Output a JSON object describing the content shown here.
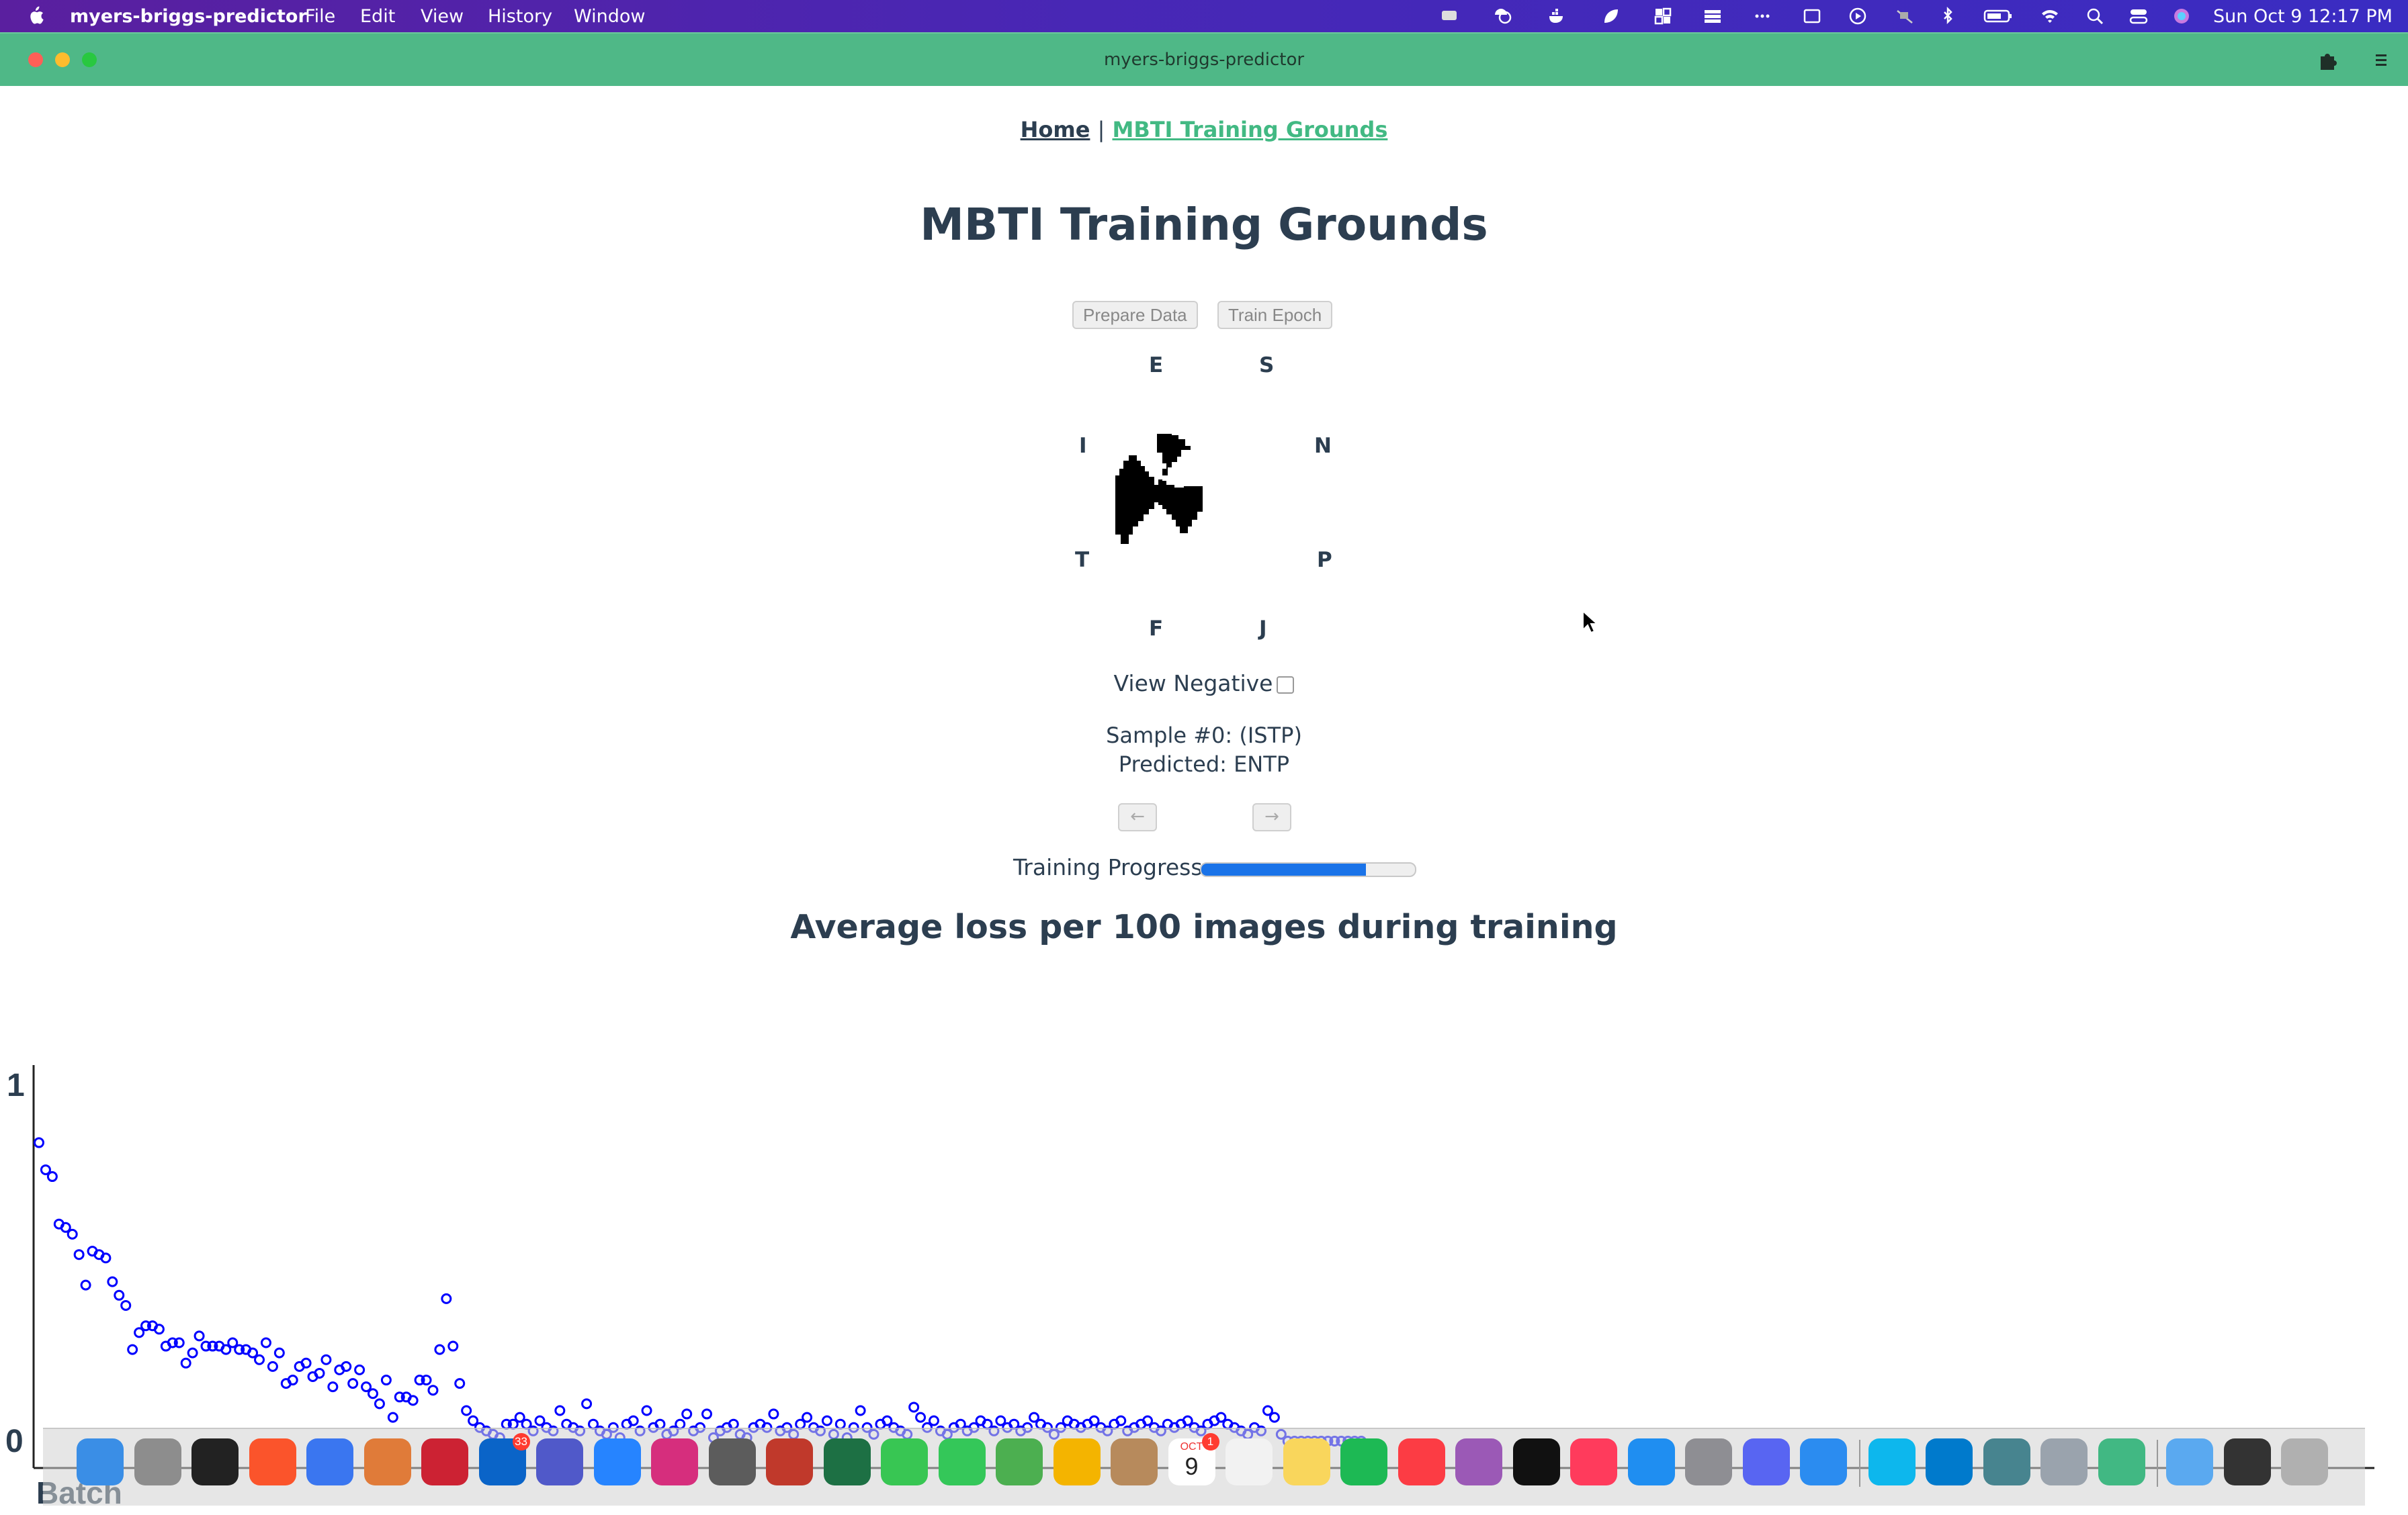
{
  "menubar": {
    "app_name": "myers-briggs-predictor",
    "menus": [
      "File",
      "Edit",
      "View",
      "History",
      "Window"
    ],
    "status_icons": [
      "speech-icon",
      "umbrella-clock-icon",
      "docker-icon",
      "leaf-icon",
      "grid-icon",
      "stack-icon",
      "more-icon",
      "display-icon",
      "play-icon",
      "mute-icon",
      "bluetooth-icon",
      "battery-icon",
      "wifi-icon",
      "search-icon",
      "control-center-icon",
      "siri-icon"
    ],
    "datetime": "Sun Oct 9  12:17 PM"
  },
  "window": {
    "title": "myers-briggs-predictor"
  },
  "nav": {
    "home": "Home",
    "separator": "|",
    "current": "MBTI Training Grounds"
  },
  "page": {
    "title": "MBTI Training Grounds",
    "prepare_button": "Prepare Data",
    "train_button": "Train Epoch",
    "axis_labels": {
      "top_left": "E",
      "top_right": "S",
      "left_top": "I",
      "right_top": "N",
      "left_bottom": "T",
      "right_bottom": "P",
      "bottom_left": "F",
      "bottom_right": "J"
    },
    "view_negative_label": "View Negative",
    "view_negative_checked": false,
    "sample_line": "Sample #0: (ISTP)",
    "predicted_line": "Predicted: ENTP",
    "prev_button": "←",
    "next_button": "→",
    "progress_label": "Training Progress",
    "progress_value": 0.77,
    "progress_color": "#1a73e8",
    "chart_title": "Average loss per 100 images during training"
  },
  "chart_data": {
    "type": "scatter",
    "title": "Average loss per 100 images during training",
    "xlabel": "Batch",
    "ylabel": "",
    "ylim": [
      0,
      1
    ],
    "yticks": [
      "1",
      "0"
    ],
    "marker_color": "#0000ff",
    "y": [
      0.89,
      0.81,
      0.79,
      0.65,
      0.64,
      0.62,
      0.56,
      0.47,
      0.57,
      0.56,
      0.55,
      0.48,
      0.44,
      0.41,
      0.28,
      0.33,
      0.35,
      0.35,
      0.34,
      0.29,
      0.3,
      0.3,
      0.24,
      0.27,
      0.32,
      0.29,
      0.29,
      0.29,
      0.28,
      0.3,
      0.28,
      0.28,
      0.27,
      0.25,
      0.3,
      0.23,
      0.27,
      0.18,
      0.19,
      0.23,
      0.24,
      0.2,
      0.21,
      0.25,
      0.17,
      0.22,
      0.23,
      0.18,
      0.22,
      0.17,
      0.15,
      0.12,
      0.19,
      0.08,
      0.14,
      0.14,
      0.13,
      0.19,
      0.19,
      0.16,
      0.28,
      0.43,
      0.29,
      0.18,
      0.1,
      0.07,
      0.05,
      0.04,
      0.03,
      0.02,
      0.06,
      0.06,
      0.08,
      0.06,
      0.04,
      0.07,
      0.05,
      0.04,
      0.1,
      0.06,
      0.05,
      0.04,
      0.12,
      0.06,
      0.04,
      0.03,
      0.05,
      0.02,
      0.06,
      0.07,
      0.04,
      0.1,
      0.05,
      0.06,
      0.03,
      0.04,
      0.06,
      0.09,
      0.04,
      0.05,
      0.09,
      0.02,
      0.04,
      0.05,
      0.06,
      0.03,
      0.02,
      0.05,
      0.06,
      0.05,
      0.09,
      0.04,
      0.05,
      0.03,
      0.06,
      0.08,
      0.05,
      0.04,
      0.07,
      0.03,
      0.06,
      0.02,
      0.05,
      0.1,
      0.05,
      0.03,
      0.06,
      0.07,
      0.05,
      0.04,
      0.03,
      0.11,
      0.08,
      0.05,
      0.07,
      0.04,
      0.03,
      0.05,
      0.06,
      0.04,
      0.05,
      0.07,
      0.06,
      0.04,
      0.07,
      0.05,
      0.06,
      0.04,
      0.05,
      0.08,
      0.06,
      0.05,
      0.03,
      0.05,
      0.07,
      0.06,
      0.05,
      0.06,
      0.07,
      0.05,
      0.04,
      0.06,
      0.07,
      0.04,
      0.05,
      0.06,
      0.07,
      0.05,
      0.04,
      0.06,
      0.05,
      0.06,
      0.07,
      0.05,
      0.04,
      0.06,
      0.07,
      0.08,
      0.06,
      0.05,
      0.04,
      0.03,
      0.05,
      0.04,
      0.1,
      0.08,
      0.03,
      0.01,
      0.01,
      0.01,
      0.01,
      0.01,
      0.01,
      0.01,
      0.01,
      0.01,
      0.01,
      0.01,
      0.01
    ]
  },
  "dock": {
    "apps": [
      "finder-icon",
      "launchpad-icon",
      "terminal-icon",
      "brave-icon",
      "signal-icon",
      "fox-app-icon",
      "crossover-icon",
      "outlook-icon",
      "teams-icon",
      "jira-icon",
      "intellij-icon",
      "toolbox-icon",
      "app-icon",
      "excel-icon",
      "facetime-icon",
      "messages-icon",
      "maps-icon",
      "photos-icon",
      "contacts-icon",
      "calendar-icon",
      "reminders-icon",
      "notes-icon",
      "spotify-icon",
      "music-icon",
      "podcasts-icon",
      "appletv-icon",
      "news-icon",
      "appstore-icon",
      "system-preferences-icon",
      "discord-icon",
      "mail-icon",
      "docker-icon",
      "vscode-icon",
      "electron-icon",
      "preview-icon",
      "vue-icon",
      "folder-icon",
      "terminal-window-icon",
      "trash-icon"
    ],
    "badges": {
      "outlook": "33",
      "calendar": "1"
    },
    "calendar_month": "OCT",
    "calendar_day": "9"
  }
}
